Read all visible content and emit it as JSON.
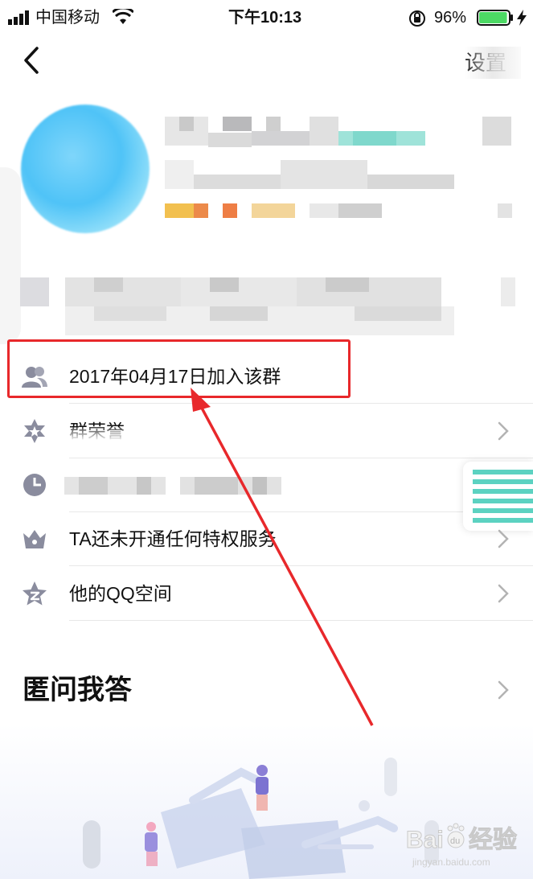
{
  "status_bar": {
    "carrier": "中国移动",
    "time": "下午10:13",
    "battery_percent": "96%",
    "battery_level": 0.96
  },
  "nav": {
    "settings_label": "设置"
  },
  "rows": {
    "join_date": "2017年04月17日加入该群",
    "group_honor": "群荣誉",
    "privilege": "TA还未开通任何特权服务",
    "qzone": "他的QQ空间"
  },
  "section": {
    "anon_qa": "匿问我答"
  },
  "watermark": {
    "brand": "Bai",
    "brand_suffix": "du",
    "brand_cn": "经验",
    "url": "jingyan.baidu.com"
  },
  "colors": {
    "highlight": "#e8282b",
    "arrow": "#e8282b",
    "avatar": "#4fc3f7",
    "icon_gray": "#8a8c9e",
    "battery": "#4cd964"
  },
  "icons": {
    "back": "chevron-left-icon",
    "members": "group-members-icon",
    "honor": "star-badge-icon",
    "history": "clock-icon",
    "privilege": "crown-icon",
    "qzone": "qzone-star-icon",
    "chevron": "chevron-right-icon"
  }
}
